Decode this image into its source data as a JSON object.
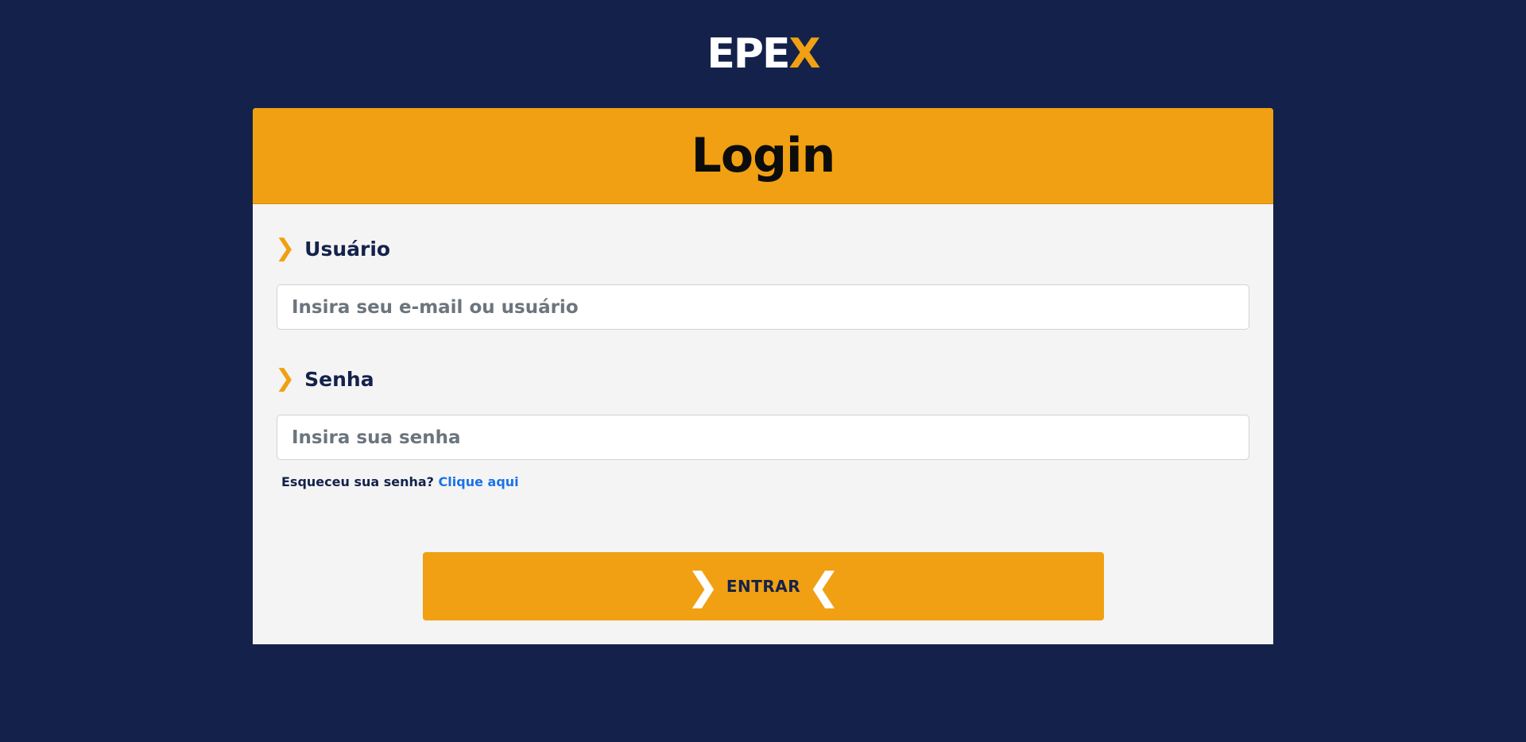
{
  "brand": {
    "logo_main": "EPE",
    "logo_accent": "X"
  },
  "card": {
    "title": "Login"
  },
  "form": {
    "user": {
      "label": "Usuário",
      "placeholder": "Insira seu e-mail ou usuário",
      "value": ""
    },
    "password": {
      "label": "Senha",
      "placeholder": "Insira sua senha",
      "value": ""
    },
    "forgot_text": "Esqueceu sua senha?",
    "forgot_link": "Clique aqui",
    "submit_label": "ENTRAR"
  },
  "icons": {
    "label_chevron": "❯",
    "button_left": "❯",
    "button_right": "❮"
  },
  "colors": {
    "background": "#14224b",
    "accent": "#f0a012",
    "card": "#f4f4f4",
    "link": "#1a73e8"
  }
}
